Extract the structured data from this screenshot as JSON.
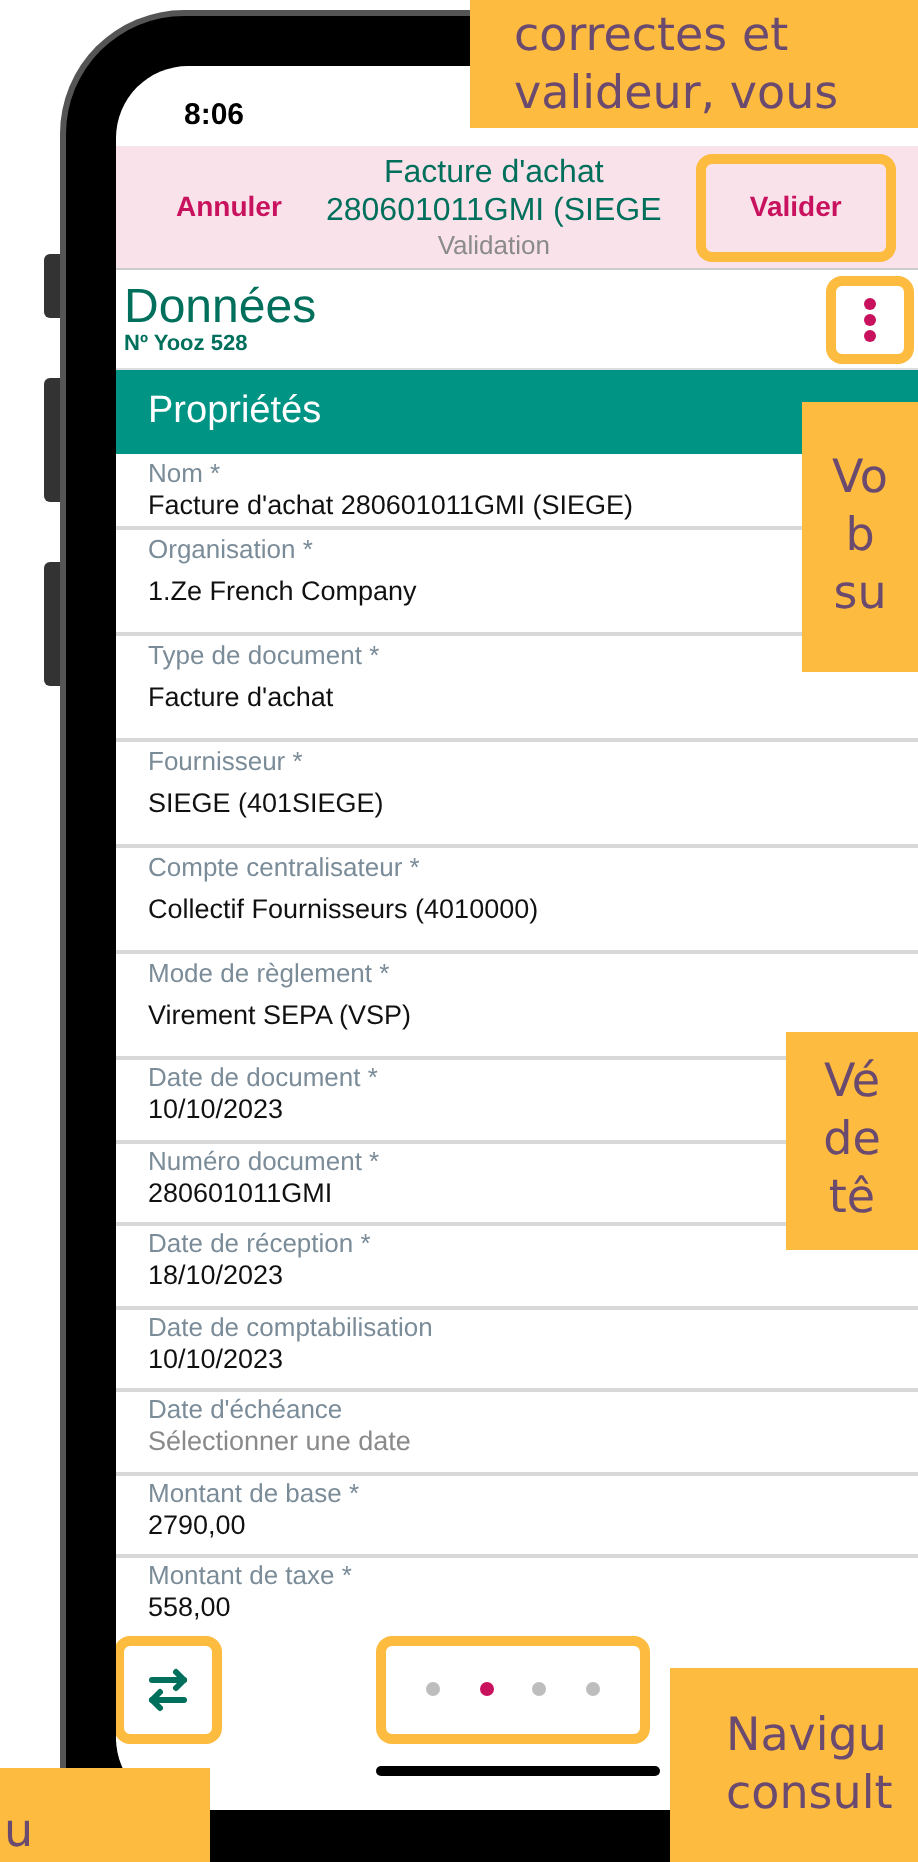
{
  "status_bar": {
    "time": "8:06"
  },
  "header": {
    "cancel": "Annuler",
    "title_lines": [
      "Facture d'achat",
      "280601011GMI (SIEGE"
    ],
    "subtitle": "Validation",
    "validate": {
      "label": "Valider",
      "highlighted": true
    }
  },
  "section": {
    "title": "Données",
    "number": "Nº Yooz 528",
    "menu_highlighted": true
  },
  "properties": {
    "title": "Propriétés",
    "fields": [
      {
        "kind": "select",
        "label": "Nom *",
        "value": "Facture d'achat 280601011GMI (SIEGE)"
      },
      {
        "kind": "select",
        "label": "Organisation *",
        "value": "1.Ze French Company"
      },
      {
        "kind": "select",
        "label": "Type de document *",
        "value": "Facture d'achat"
      },
      {
        "kind": "select",
        "label": "Fournisseur *",
        "value": "SIEGE (401SIEGE)"
      },
      {
        "kind": "select",
        "label": "Compte centralisateur *",
        "value": "Collectif Fournisseurs (4010000)"
      },
      {
        "kind": "select",
        "label": "Mode de règlement *",
        "value": "Virement SEPA (VSP)"
      },
      {
        "kind": "text",
        "label": "Date de document *",
        "value": "10/10/2023"
      },
      {
        "kind": "text",
        "label": "Numéro document *",
        "value": "280601011GMI"
      },
      {
        "kind": "text",
        "label": "Date de réception *",
        "value": "18/10/2023"
      },
      {
        "kind": "text",
        "label": "Date de comptabilisation",
        "value": "10/10/2023"
      },
      {
        "kind": "text",
        "label": "Date d'échéance",
        "placeholder": "Sélectionner une date"
      },
      {
        "kind": "text",
        "label": "Montant de base *",
        "value": "2790,00"
      },
      {
        "kind": "text",
        "label": "Montant de taxe *",
        "value": "558,00"
      }
    ]
  },
  "toolbar": {
    "swap_highlighted": true,
    "pager_highlighted": true,
    "dots": [
      {
        "selected": false
      },
      {
        "selected": true
      },
      {
        "selected": false
      },
      {
        "selected": false
      }
    ]
  },
  "callouts": [
    {
      "lines": [
        "correctes et",
        "valideur, vous"
      ]
    },
    {
      "lines": [
        "Vo",
        "b",
        "su"
      ]
    },
    {
      "lines": [
        "Vé",
        "de",
        "tê"
      ]
    },
    {
      "lines": [
        "Navigu",
        "consult"
      ]
    },
    {
      "lines": [
        "u"
      ]
    }
  ]
}
